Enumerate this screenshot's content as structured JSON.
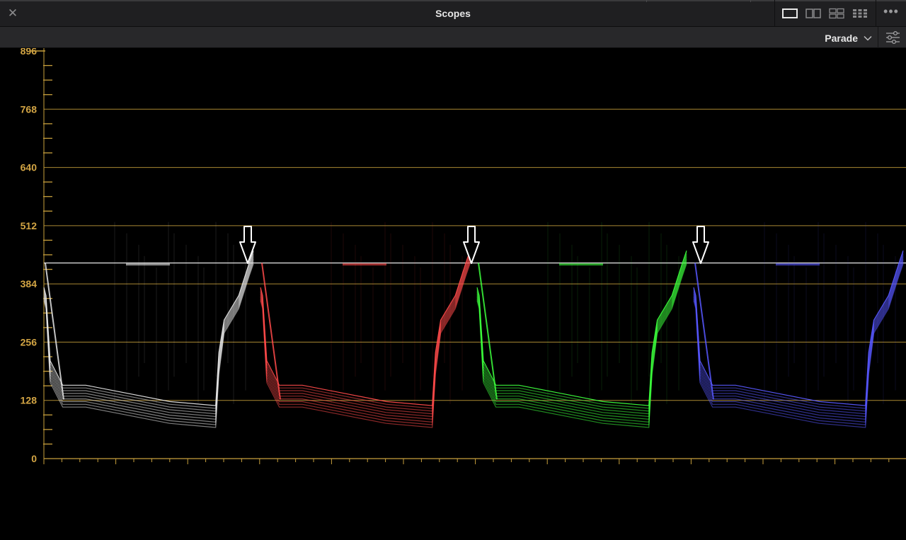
{
  "window": {
    "title": "Scopes",
    "close_icon": "close-icon",
    "layout_icons": [
      "single-view-icon",
      "dual-view-icon",
      "quad-view-icon",
      "grid-view-icon"
    ],
    "more_icon": "more-options-icon"
  },
  "toolbar": {
    "scope_mode": "Parade",
    "dropdown_icon": "chevron-down-icon",
    "settings_icon": "sliders-settings-icon"
  },
  "scope": {
    "type": "parade",
    "y_range": [
      0,
      896
    ],
    "y_labels": [
      "896",
      "768",
      "640",
      "512",
      "384",
      "256",
      "128",
      "0"
    ],
    "graticule_color": "#c8a03c",
    "label_color": "#d3a544",
    "reference_level": 430,
    "channels": [
      {
        "name": "luma",
        "color": "#e6e6e6"
      },
      {
        "name": "red",
        "color": "#ff4a4a"
      },
      {
        "name": "green",
        "color": "#3dff3d"
      },
      {
        "name": "blue",
        "color": "#5858ff"
      }
    ],
    "markers": [
      {
        "icon": "down-arrow-icon",
        "channel": "luma"
      },
      {
        "icon": "down-arrow-icon",
        "channel": "red"
      },
      {
        "icon": "down-arrow-icon",
        "channel": "blue"
      }
    ]
  }
}
